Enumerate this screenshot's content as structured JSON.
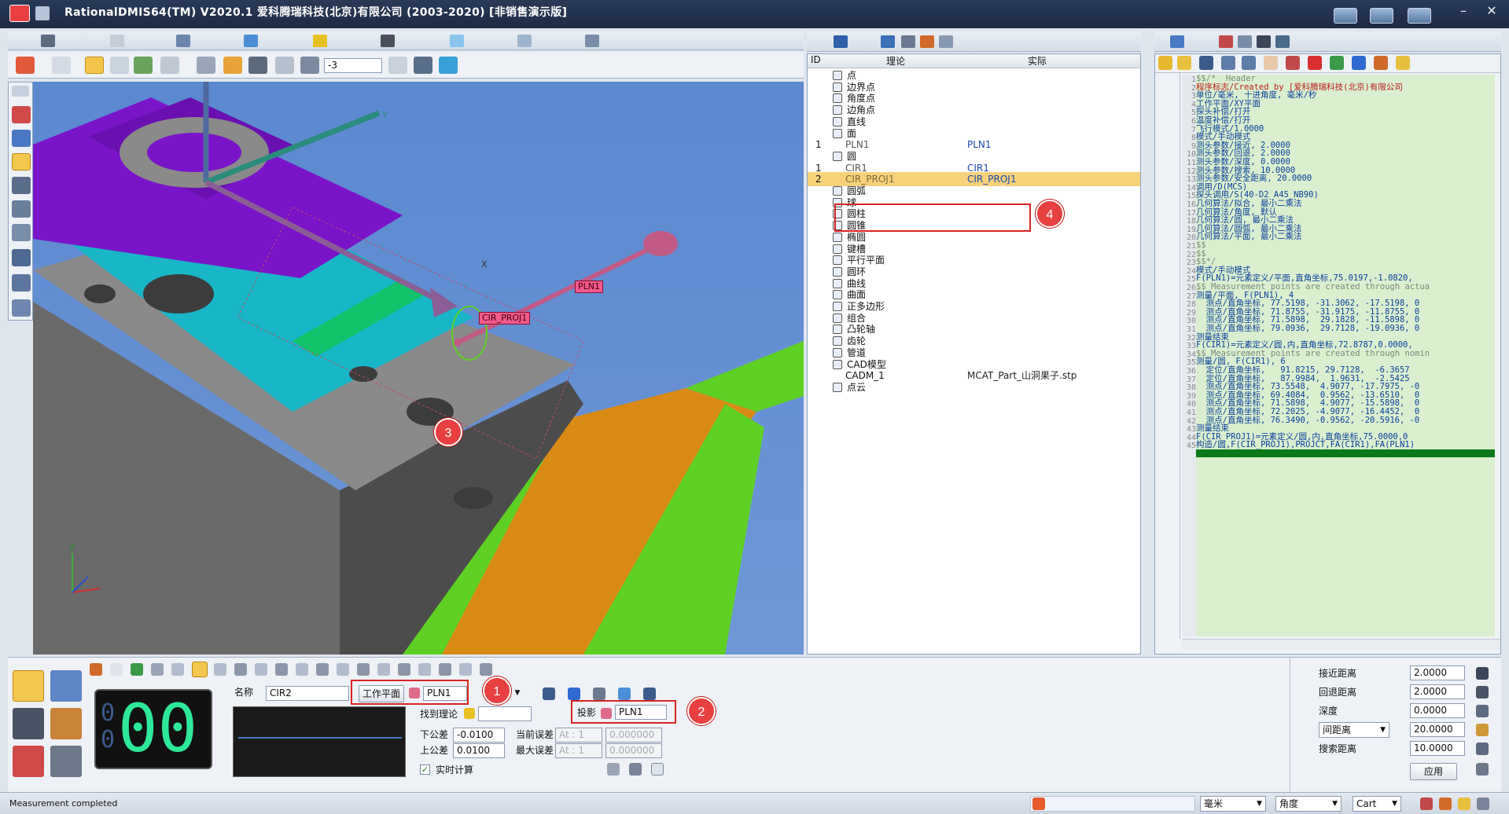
{
  "app": {
    "title": "RationalDMIS64(TM) V2020.1   爱科腾瑞科技(北京)有限公司 (2003-2020) [非销售演示版]"
  },
  "toolbar": {
    "step_value": "-3"
  },
  "viewport": {
    "labels": {
      "pln1": "PLN1",
      "cir_proj1": "CIR_PROJ1",
      "axis_z": "Z",
      "axis_y": "Y",
      "axis_x": "X"
    },
    "callout_3": "3"
  },
  "tree": {
    "headers": {
      "id": "ID",
      "theory": "理论",
      "actual": "实际"
    },
    "rows": [
      {
        "id": "",
        "name": "点",
        "actual": ""
      },
      {
        "id": "",
        "name": "边界点",
        "actual": ""
      },
      {
        "id": "",
        "name": "角度点",
        "actual": ""
      },
      {
        "id": "",
        "name": "边角点",
        "actual": ""
      },
      {
        "id": "",
        "name": "直线",
        "actual": ""
      },
      {
        "id": "",
        "name": "面",
        "actual": ""
      },
      {
        "id": "1",
        "name": "PLN1",
        "actual": "PLN1"
      },
      {
        "id": "",
        "name": "圆",
        "actual": ""
      },
      {
        "id": "1",
        "name": "CIR1",
        "actual": "CIR1"
      },
      {
        "id": "2",
        "name": "CIR_PROJ1",
        "actual": "CIR_PROJ1"
      },
      {
        "id": "",
        "name": "圆弧",
        "actual": ""
      },
      {
        "id": "",
        "name": "球",
        "actual": ""
      },
      {
        "id": "",
        "name": "圆柱",
        "actual": ""
      },
      {
        "id": "",
        "name": "圆锥",
        "actual": ""
      },
      {
        "id": "",
        "name": "椭圆",
        "actual": ""
      },
      {
        "id": "",
        "name": "键槽",
        "actual": ""
      },
      {
        "id": "",
        "name": "平行平面",
        "actual": ""
      },
      {
        "id": "",
        "name": "圆环",
        "actual": ""
      },
      {
        "id": "",
        "name": "曲线",
        "actual": ""
      },
      {
        "id": "",
        "name": "曲面",
        "actual": ""
      },
      {
        "id": "",
        "name": "正多边形",
        "actual": ""
      },
      {
        "id": "",
        "name": "组合",
        "actual": ""
      },
      {
        "id": "",
        "name": "凸轮轴",
        "actual": ""
      },
      {
        "id": "",
        "name": "齿轮",
        "actual": ""
      },
      {
        "id": "",
        "name": "管道",
        "actual": ""
      },
      {
        "id": "",
        "name": "CAD模型",
        "actual": ""
      },
      {
        "id": "",
        "name": "CADM_1",
        "actual": "MCAT_Part_山洞果子.stp"
      },
      {
        "id": "",
        "name": "点云",
        "actual": ""
      }
    ],
    "callout_4": "4"
  },
  "code": {
    "lines": [
      "$$/*  Header",
      "程序标志/Created by [爱科腾瑞科技(北京)有限公司",
      "单位/毫米, 十进角度, 毫米/秒",
      "工作平面/XY平面",
      "探头补偿/打开",
      "温度补偿/打开",
      "飞行模式/1.0000",
      "模式/手动模式",
      "测头参数/接近, 2.0000",
      "测头参数/回退, 2.0000",
      "测头参数/深度, 0.0000",
      "测头参数/搜索, 10.0000",
      "测头参数/安全距离, 20.0000",
      "调用/D(MCS)",
      "探头调用/S(40-D2_A45_NB90)",
      "几何算法/拟合, 最小二乘法",
      "几何算法/角度, 默认",
      "几何算法/圆, 最小二乘法",
      "几何算法/圆弧, 最小二乘法",
      "几何算法/平面, 最小二乘法",
      "$$",
      "$$",
      "$$*/",
      "模式/手动模式",
      "F(PLN1)=元素定义/平面,直角坐标,75.0197,-1.0820,",
      "$$ Measurement points are created through actua",
      "测量/平面, F(PLN1), 4",
      "  测点/直角坐标, 77.5198, -31.3062, -17.5198, 0",
      "  测点/直角坐标, 71.8755, -31.9175, -11.8755, 0",
      "  测点/直角坐标, 71.5898,  29.1828, -11.5898, 0",
      "  测点/直角坐标, 79.0936,  29.7128, -19.0936, 0",
      "测量结束",
      "F(CIR1)=元素定义/圆,内,直角坐标,72.8787,0.0000,",
      "$$ Measurement points are created through nomin",
      "测量/圆, F(CIR1), 6",
      "  定位/直角坐标,   91.8215, 29.7128,  -6.3657",
      "  定位/直角坐标,   87.9984,  1.9631,  -2.5425",
      "  测点/直角坐标, 73.5548,  4.9077, -17.7975, -0",
      "  测点/直角坐标, 69.4084,  0.9562, -13.6510,  0",
      "  测点/直角坐标, 71.5898,  4.9077, -15.5898,  0",
      "  测点/直角坐标, 72.2025, -4.9077, -16.4452,  0",
      "  测点/直角坐标, 76.3490, -0.9562, -20.5916, -0",
      "测量结束",
      "F(CIR_PROJ1)=元素定义/圆,内,直角坐标,75.0000,0",
      "构造/圆,F(CIR_PROJ1),PROJCT,FA(CIR1),FA(PLN1)"
    ]
  },
  "bottom": {
    "counter": "00",
    "name_label": "名称",
    "name_value": "CIR2",
    "workplane_button": "工作平面",
    "workplane_value": "PLN1",
    "find_theory_label": "找到理论",
    "projection_label": "投影",
    "projection_value": "PLN1",
    "lower_tol_label": "下公差",
    "lower_tol_value": "-0.0100",
    "upper_tol_label": "上公差",
    "upper_tol_value": "0.0100",
    "current_err_label": "当前误差",
    "max_err_label": "最大误差",
    "current_err_at": "At : 1",
    "current_err_value": "0.000000",
    "max_err_at": "At : 1",
    "max_err_value": "0.000000",
    "realtime_label": "实时计算",
    "callout_1": "1",
    "callout_2": "2"
  },
  "params": {
    "approach_label": "接近距离",
    "approach_value": "2.0000",
    "retract_label": "回退距离",
    "retract_value": "2.0000",
    "depth_label": "深度",
    "depth_value": "0.0000",
    "clearance_select": "间距离",
    "clearance_value": "20.0000",
    "search_label": "搜索距离",
    "search_value": "10.0000",
    "apply_button": "应用"
  },
  "status": {
    "message": "Measurement completed",
    "unit_select": "毫米",
    "angle_select": "角度",
    "coord_select": "Cart"
  },
  "colors": {
    "purple": "#7a14c9",
    "cyan": "#19b6c7",
    "green": "#5ed024",
    "orange": "#d98a14",
    "tag_pink": "#f25a8a",
    "callout_red": "#e84040",
    "highlight_row": "#f7d27a"
  }
}
